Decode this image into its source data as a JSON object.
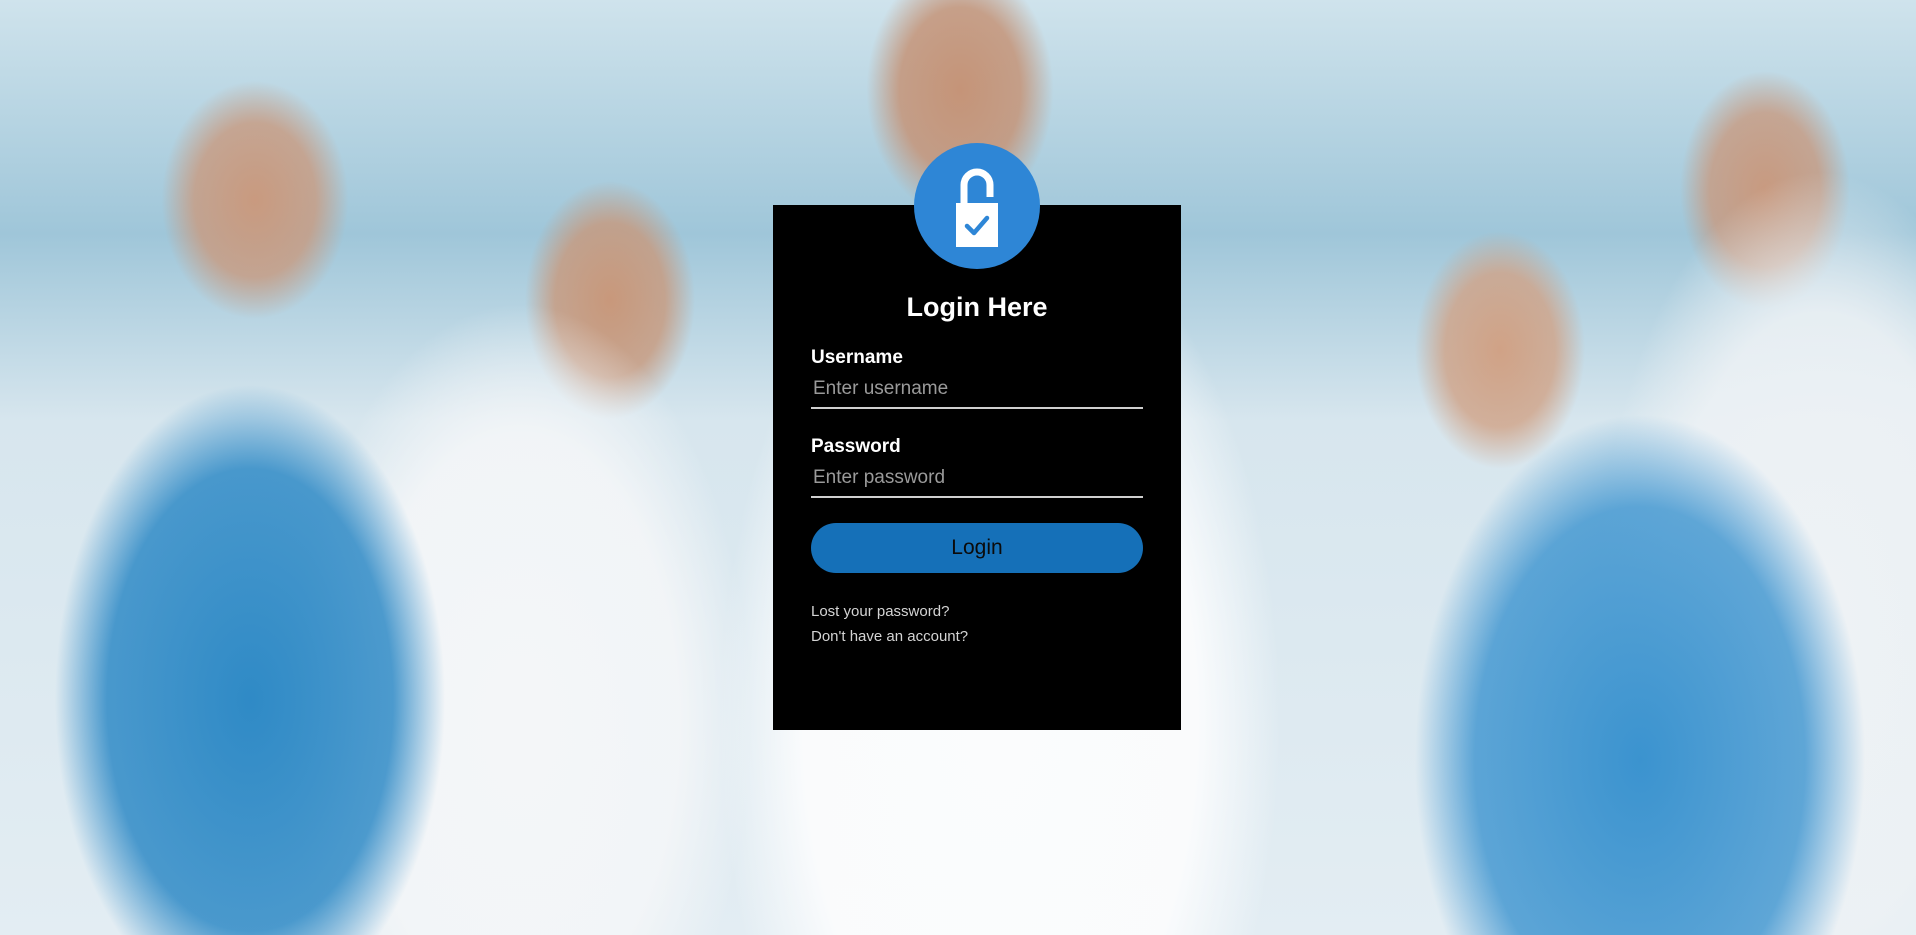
{
  "login": {
    "title": "Login Here",
    "username_label": "Username",
    "username_placeholder": "Enter username",
    "password_label": "Password",
    "password_placeholder": "Enter password",
    "submit_label": "Login",
    "lost_password_link": "Lost your password?",
    "register_link": "Don't have an account?",
    "avatar_icon": "lock-check-icon",
    "accent_color": "#2e86d6",
    "button_color": "#1570b8",
    "box_color": "#000000"
  }
}
